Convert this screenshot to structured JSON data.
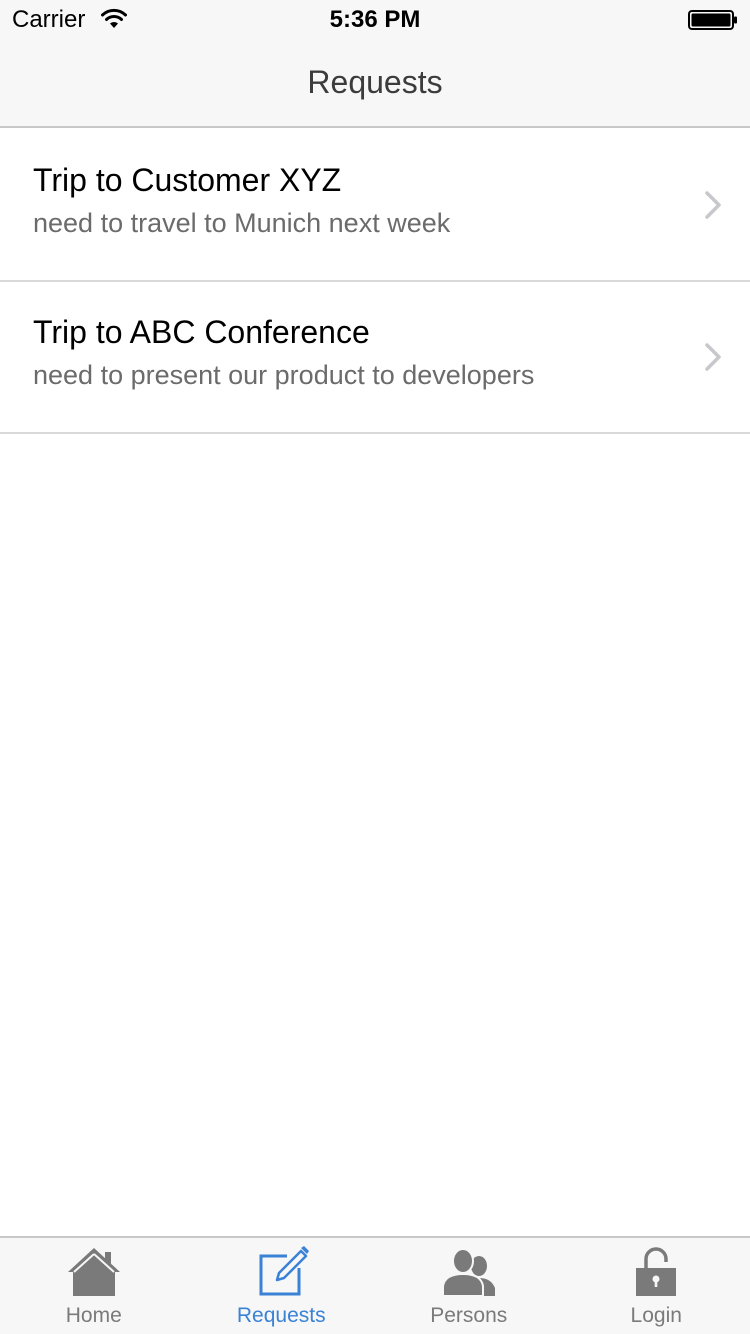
{
  "status_bar": {
    "carrier": "Carrier",
    "time": "5:36 PM"
  },
  "nav": {
    "title": "Requests"
  },
  "requests": [
    {
      "title": "Trip to Customer XYZ",
      "subtitle": "need to travel to Munich next week"
    },
    {
      "title": "Trip to ABC Conference",
      "subtitle": "need to present our product to developers"
    }
  ],
  "tabs": [
    {
      "label": "Home",
      "icon": "home-icon",
      "active": false
    },
    {
      "label": "Requests",
      "icon": "compose-icon",
      "active": true
    },
    {
      "label": "Persons",
      "icon": "persons-icon",
      "active": false
    },
    {
      "label": "Login",
      "icon": "lock-icon",
      "active": false
    }
  ],
  "colors": {
    "accent": "#3a82d6",
    "inactive_tab": "#7a7a7a",
    "bar_background": "#f7f7f7"
  }
}
